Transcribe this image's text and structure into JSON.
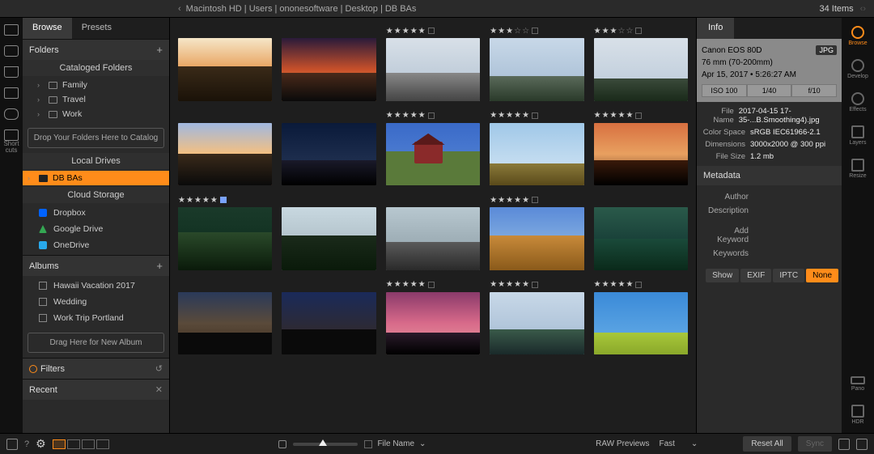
{
  "topbar": {
    "breadcrumb": "Macintosh HD | Users | ononesoftware | Desktop | DB BAs",
    "item_count": "34 Items"
  },
  "left_tabs": {
    "browse": "Browse",
    "presets": "Presets"
  },
  "folders": {
    "header": "Folders",
    "cataloged": "Cataloged Folders",
    "items": [
      "Family",
      "Travel",
      "Work"
    ],
    "dropzone": "Drop Your Folders Here to Catalog",
    "local": "Local Drives",
    "local_sel": "DB BAs",
    "cloud": "Cloud Storage",
    "cloud_items": [
      "Dropbox",
      "Google Drive",
      "OneDrive"
    ]
  },
  "albums": {
    "header": "Albums",
    "items": [
      "Hawaii Vacation 2017",
      "Wedding",
      "Work Trip Portland"
    ],
    "dropzone": "Drag Here for New Album"
  },
  "filters": {
    "header": "Filters"
  },
  "recent": {
    "header": "Recent"
  },
  "info": {
    "tab": "Info",
    "camera": "Canon EOS 80D",
    "format": "JPG",
    "lens": "76 mm (70-200mm)",
    "datetime": "Apr 15, 2017 • 5:26:27 AM",
    "iso": "ISO 100",
    "shutter": "1/40",
    "aperture": "f/10",
    "filename_label": "File Name",
    "filename": "2017-04-15 17-35-...B.Smoothing4).jpg",
    "colorspace_label": "Color Space",
    "colorspace": "sRGB IEC61966-2.1",
    "dimensions_label": "Dimensions",
    "dimensions": "3000x2000 @ 300 ppi",
    "filesize_label": "File Size",
    "filesize": "1.2 mb"
  },
  "metadata": {
    "header": "Metadata",
    "author": "Author",
    "description": "Description",
    "add_keyword": "Add Keyword",
    "keywords": "Keywords",
    "buttons": {
      "show": "Show",
      "exif": "EXIF",
      "iptc": "IPTC",
      "none": "None"
    }
  },
  "right_rail": {
    "browse": "Browse",
    "develop": "Develop",
    "effects": "Effects",
    "layers": "Layers",
    "resize": "Resize",
    "pano": "Pano",
    "hdr": "HDR"
  },
  "bottom": {
    "sort_label": "File Name",
    "raw_label": "RAW Previews",
    "raw_value": "Fast",
    "reset": "Reset All",
    "sync": "Sync"
  },
  "thumbs": [
    {
      "rating": 0,
      "variant": "t1"
    },
    {
      "rating": 0,
      "variant": "t2"
    },
    {
      "rating": 5,
      "variant": "t3"
    },
    {
      "rating": 3,
      "variant": "t4"
    },
    {
      "rating": 3,
      "variant": "t5"
    },
    {
      "rating": 0,
      "variant": "t6"
    },
    {
      "rating": 0,
      "variant": "t7"
    },
    {
      "rating": 5,
      "variant": "t8",
      "barn": true
    },
    {
      "rating": 5,
      "variant": "t9"
    },
    {
      "rating": 5,
      "variant": "t10"
    },
    {
      "rating": 5,
      "variant": "t11",
      "sel": true
    },
    {
      "rating": 0,
      "variant": "t12"
    },
    {
      "rating": 0,
      "variant": "t13"
    },
    {
      "rating": 5,
      "variant": "t14"
    },
    {
      "rating": 0,
      "variant": "t15"
    },
    {
      "rating": 0,
      "variant": "t16"
    },
    {
      "rating": 0,
      "variant": "t17"
    },
    {
      "rating": 5,
      "variant": "t18"
    },
    {
      "rating": 5,
      "variant": "t19"
    },
    {
      "rating": 5,
      "variant": "t20"
    }
  ],
  "shortcuts_label": "Short\ncuts"
}
